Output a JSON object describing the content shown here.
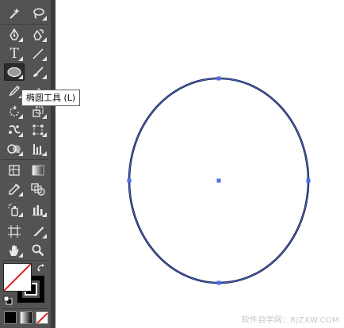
{
  "toolbar": {
    "tooltip": "椭圆工具 (L)",
    "tools_left": [
      {
        "name": "magic-wand-tool",
        "icon": "magic-wand-icon"
      },
      {
        "name": "pen-tool",
        "icon": "pen-icon"
      },
      {
        "name": "type-tool",
        "icon": "type-icon",
        "glyph": "T"
      },
      {
        "name": "ellipse-tool",
        "icon": "ellipse-icon",
        "active": true
      },
      {
        "name": "pencil-tool",
        "icon": "pencil-icon"
      },
      {
        "name": "rotate-tool",
        "icon": "rotate-icon"
      },
      {
        "name": "puppet-warp-tool",
        "icon": "puppet-warp-icon"
      },
      {
        "name": "shape-builder-tool",
        "icon": "shape-builder-icon"
      },
      {
        "name": "mesh-tool",
        "icon": "mesh-icon"
      },
      {
        "name": "eyedropper-tool",
        "icon": "eyedropper-icon"
      },
      {
        "name": "symbol-sprayer-tool",
        "icon": "symbol-sprayer-icon"
      },
      {
        "name": "artboard-tool",
        "icon": "artboard-icon"
      },
      {
        "name": "hand-tool",
        "icon": "hand-icon"
      }
    ],
    "tools_right": [
      {
        "name": "lasso-tool",
        "icon": "lasso-icon"
      },
      {
        "name": "curvature-tool",
        "icon": "curvature-icon"
      },
      {
        "name": "line-segment-tool",
        "icon": "line-segment-icon"
      },
      {
        "name": "paintbrush-tool",
        "icon": "paintbrush-icon"
      },
      {
        "name": "eraser-tool",
        "icon": "eraser-icon"
      },
      {
        "name": "scale-tool",
        "icon": "scale-icon"
      },
      {
        "name": "free-transform-tool",
        "icon": "free-transform-icon"
      },
      {
        "name": "perspective-grid-tool",
        "icon": "perspective-grid-icon"
      },
      {
        "name": "gradient-tool",
        "icon": "gradient-icon"
      },
      {
        "name": "blend-tool",
        "icon": "blend-icon"
      },
      {
        "name": "column-graph-tool",
        "icon": "column-graph-icon"
      },
      {
        "name": "slice-tool",
        "icon": "slice-icon"
      },
      {
        "name": "zoom-tool",
        "icon": "zoom-icon"
      }
    ],
    "fill_stroke": {
      "fill": "none",
      "stroke": "#000000"
    },
    "color_modes": [
      "color",
      "gradient",
      "none"
    ]
  },
  "canvas": {
    "ellipse_stroke_color": "#1a1f3a",
    "anchor_color": "#4f6fe8"
  },
  "watermark": "软件自学网：RJZXW.COM"
}
